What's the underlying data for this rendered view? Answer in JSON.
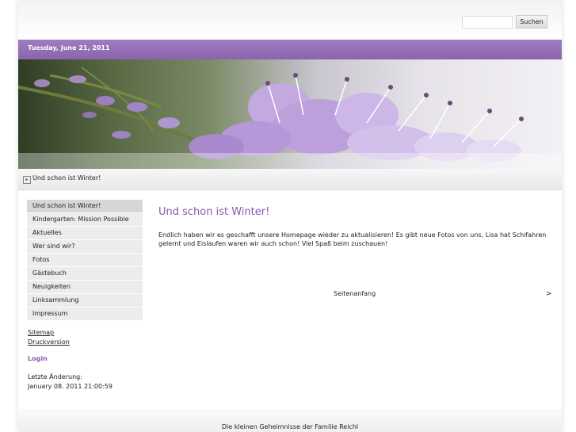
{
  "search": {
    "button_label": "Suchen",
    "placeholder": ""
  },
  "header": {
    "date": "Tuesday, June 21, 2011"
  },
  "breadcrumb": {
    "current": "Und schon ist Winter!"
  },
  "nav": {
    "items": [
      "Und schon ist Winter!",
      "Kindergarten: Mission Possible",
      "Aktuelles",
      "Wer sind wir?",
      "Fotos",
      "Gästebuch",
      "Neuigkeiten",
      "Linksammlung",
      "Impressum"
    ]
  },
  "sidebar": {
    "sitemap": "Sitemap",
    "print": "Druckversion",
    "login": "Login",
    "lastmod_label": "Letzte Änderung:",
    "lastmod_value": "January 08. 2011 21:00:59"
  },
  "main": {
    "title": "Und schon ist Winter!",
    "body": "Endlich haben wir es geschafft unsere Homepage wieder zu aktualisieren! Es gibt neue Fotos von uns, Lisa hat Schifahren gelernt und Eislaufen waren wir auch schon! Viel Spaß beim zuschauen!",
    "top_link": "Seitenanfang",
    "next_link": ">"
  },
  "footer": {
    "text": "Die kleinen Geheimnisse der Familie Reichl"
  },
  "colors": {
    "accent": "#8a5aa8",
    "datebar": "#9a74bb"
  }
}
